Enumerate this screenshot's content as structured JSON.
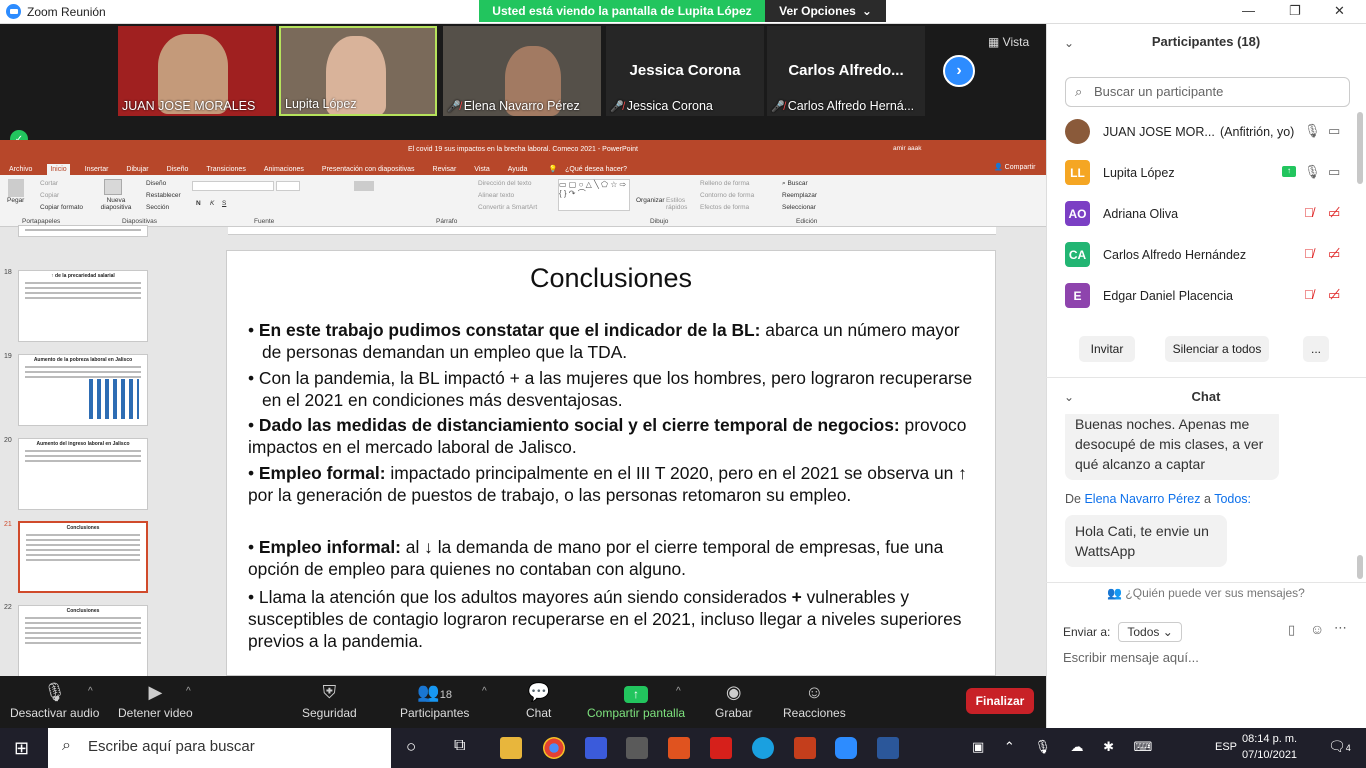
{
  "window": {
    "title": "Zoom Reunión",
    "banner": "Usted está viendo la pantalla de Lupita López",
    "view_options": "Ver Opciones"
  },
  "gallery": {
    "tiles": [
      {
        "name": "JUAN JOSE MORALES",
        "bg": "#a02020"
      },
      {
        "name": "Lupita López",
        "bg": "#7a6a5a"
      },
      {
        "name": "Elena Navarro Pérez",
        "bg": "#555049"
      },
      {
        "name": "Jessica Corona",
        "bg": "#262626"
      },
      {
        "name": "Carlos Alfredo Herná...",
        "bg": "#262626"
      }
    ],
    "big_names": [
      "Jessica Corona",
      "Carlos  Alfredo..."
    ],
    "view_label": "Vista"
  },
  "ppt": {
    "title": "El covid 19 sus impactos en la brecha laboral. Comeco 2021  -  PowerPoint",
    "user": "amir aaak",
    "share_label": "Compartir",
    "menu": [
      "Archivo",
      "Inicio",
      "Insertar",
      "Dibujar",
      "Diseño",
      "Transiciones",
      "Animaciones",
      "Presentación con diapositivas",
      "Revisar",
      "Vista",
      "Ayuda",
      "¿Qué desea hacer?"
    ],
    "ribbon": {
      "paste": "Pegar",
      "cut": "Cortar",
      "copy": "Copiar",
      "copy_format": "Copiar formato",
      "new_slide": "Nueva diapositiva",
      "design": "Diseño",
      "reset": "Restablecer",
      "section": "Sección",
      "text_dir": "Dirección del texto",
      "align_text": "Alinear texto",
      "smartart": "Convertir a SmartArt",
      "arrange": "Organizar",
      "quick_styles": "Estilos rápidos",
      "fill": "Relleno de forma",
      "outline": "Contorno de forma",
      "effects": "Efectos de forma",
      "find": "Buscar",
      "replace": "Reemplazar",
      "select": "Seleccionar",
      "groups": [
        "Portapapeles",
        "Diapositivas",
        "Fuente",
        "Párrafo",
        "Dibujo",
        "Edición"
      ]
    },
    "thumbs": [
      {
        "num": "18",
        "title": "↑ de la precariedad salarial"
      },
      {
        "num": "19",
        "title": "Aumento de la pobreza laboral en Jalisco"
      },
      {
        "num": "20",
        "title": "Aumento del ingreso laboral en Jalisco"
      },
      {
        "num": "21",
        "title": "Conclusiones"
      },
      {
        "num": "22",
        "title": "Conclusiones"
      }
    ],
    "slide": {
      "title": "Conclusiones",
      "b1_bold": "En este trabajo pudimos constatar que el indicador de la BL:",
      "b1_rest": " abarca un número mayor de personas demandan un empleo que la TDA.",
      "b2": "Con la pandemia, la BL impactó + a las mujeres que los hombres, pero lograron recuperarse en el 2021 en condiciones más desventajosas.",
      "b3_bold": "Dado las medidas de distanciamiento social y el cierre temporal de negocios:",
      "b3_rest": " provoco impactos en el mercado laboral de Jalisco.",
      "b4_bold": "Empleo formal:",
      "b4_rest": " impactado principalmente en el III T 2020, pero en el 2021 se observa un ↑ por la generación de puestos de trabajo, o las personas retomaron su empleo.",
      "b5_bold": "Empleo informal:",
      "b5_rest": " al ↓ la demanda de mano por el cierre temporal de empresas, fue una opción de empleo para quienes no contaban con alguno.",
      "b6_a": "Llama la atención que los adultos mayores aún siendo considerados ",
      "b6_plus": "+",
      "b6_b": " vulnerables y susceptibles de contagio lograron recuperarse en el 2021, incluso llegar a niveles superiores previos a la pandemia."
    }
  },
  "toolbar": {
    "mute": "Desactivar audio",
    "video": "Detener video",
    "security": "Seguridad",
    "participants": "Participantes",
    "participants_count": "18",
    "chat": "Chat",
    "share": "Compartir pantalla",
    "record": "Grabar",
    "reactions": "Reacciones",
    "end": "Finalizar"
  },
  "participants_panel": {
    "header": "Participantes (18)",
    "search_placeholder": "Buscar un participante",
    "list": [
      {
        "initials": "",
        "name": "JUAN JOSE MOR...",
        "role": "(Anfitrión, yo)",
        "color": "#8a5a3a"
      },
      {
        "initials": "LL",
        "name": "Lupita López",
        "role": "",
        "color": "#f5a623"
      },
      {
        "initials": "AO",
        "name": "Adriana Oliva",
        "role": "",
        "color": "#7b3fc4"
      },
      {
        "initials": "CA",
        "name": "Carlos Alfredo Hernández",
        "role": "",
        "color": "#22b573"
      },
      {
        "initials": "E",
        "name": "Edgar Daniel Placencia",
        "role": "",
        "color": "#8e44ad"
      }
    ],
    "invite": "Invitar",
    "mute_all": "Silenciar a todos",
    "more": "..."
  },
  "chat": {
    "header": "Chat",
    "msg1": "Buenas noches. Apenas me desocupé de mis clases, a ver qué alcanzo a captar",
    "from_prefix": "De",
    "from_name": "Elena Navarro Pérez",
    "from_sep": "a",
    "from_to": "Todos:",
    "msg2": "Hola Cati, te envie un WattsApp",
    "who_sees": "¿Quién puede ver sus mensajes?",
    "send_to_label": "Enviar a:",
    "send_to_value": "Todos",
    "input_placeholder": "Escribir mensaje aquí..."
  },
  "taskbar": {
    "search": "Escribe aquí para buscar",
    "lang": "ESP",
    "time": "08:14 p. m.",
    "date": "07/10/2021",
    "notif": "4"
  }
}
